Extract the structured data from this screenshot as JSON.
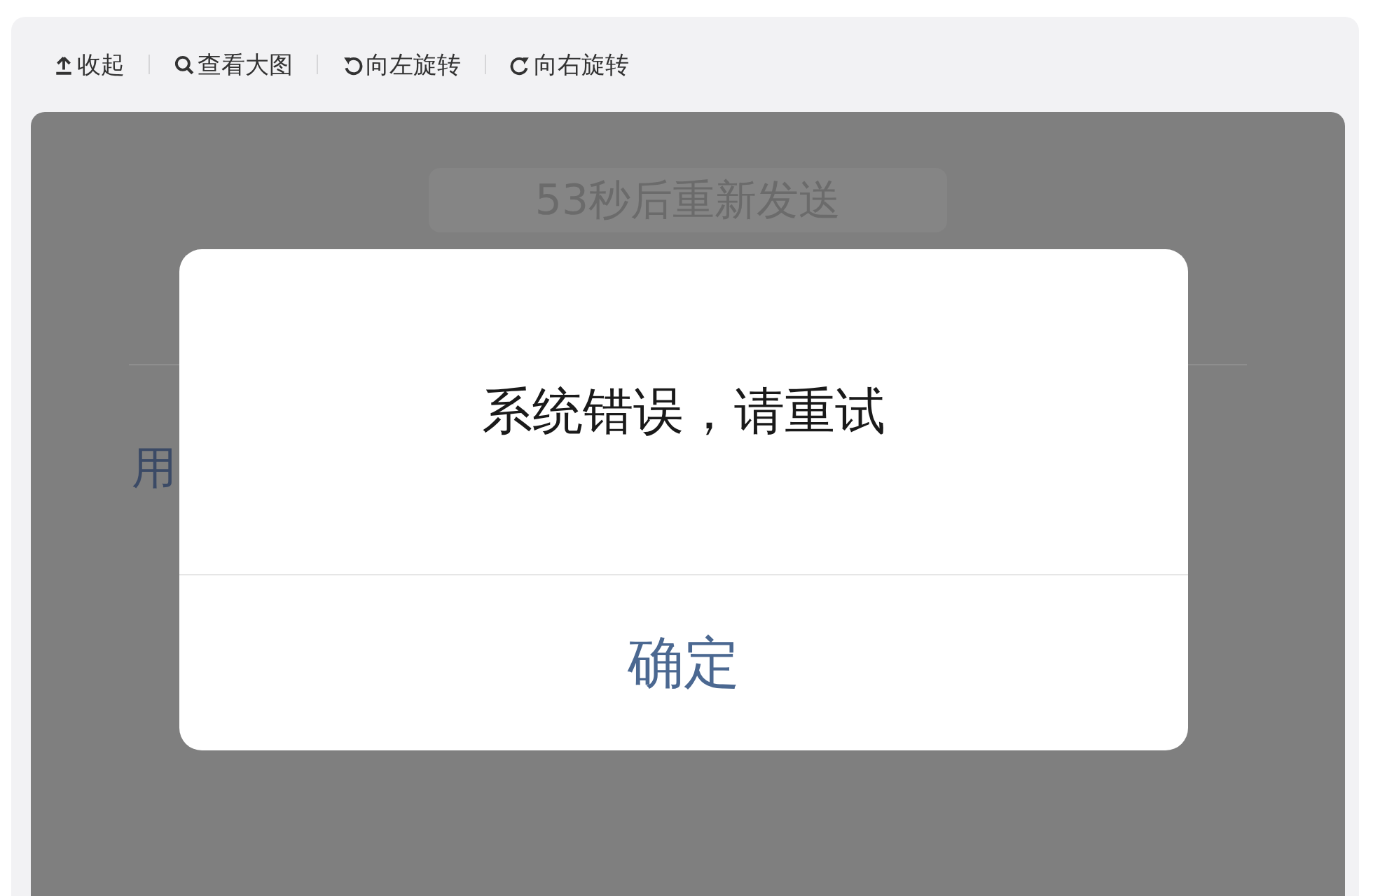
{
  "toolbar": {
    "actions": [
      {
        "kind": "collapse",
        "label": "收起"
      },
      {
        "kind": "zoom",
        "label": "查看大图"
      },
      {
        "kind": "rotate-left",
        "label": "向左旋转"
      },
      {
        "kind": "rotate-right",
        "label": "向右旋转"
      }
    ]
  },
  "screenshot": {
    "resend_button": "53秒后重新发送",
    "field_label": "用",
    "dialog": {
      "message": "系统错误，请重试",
      "button": "确定"
    }
  }
}
